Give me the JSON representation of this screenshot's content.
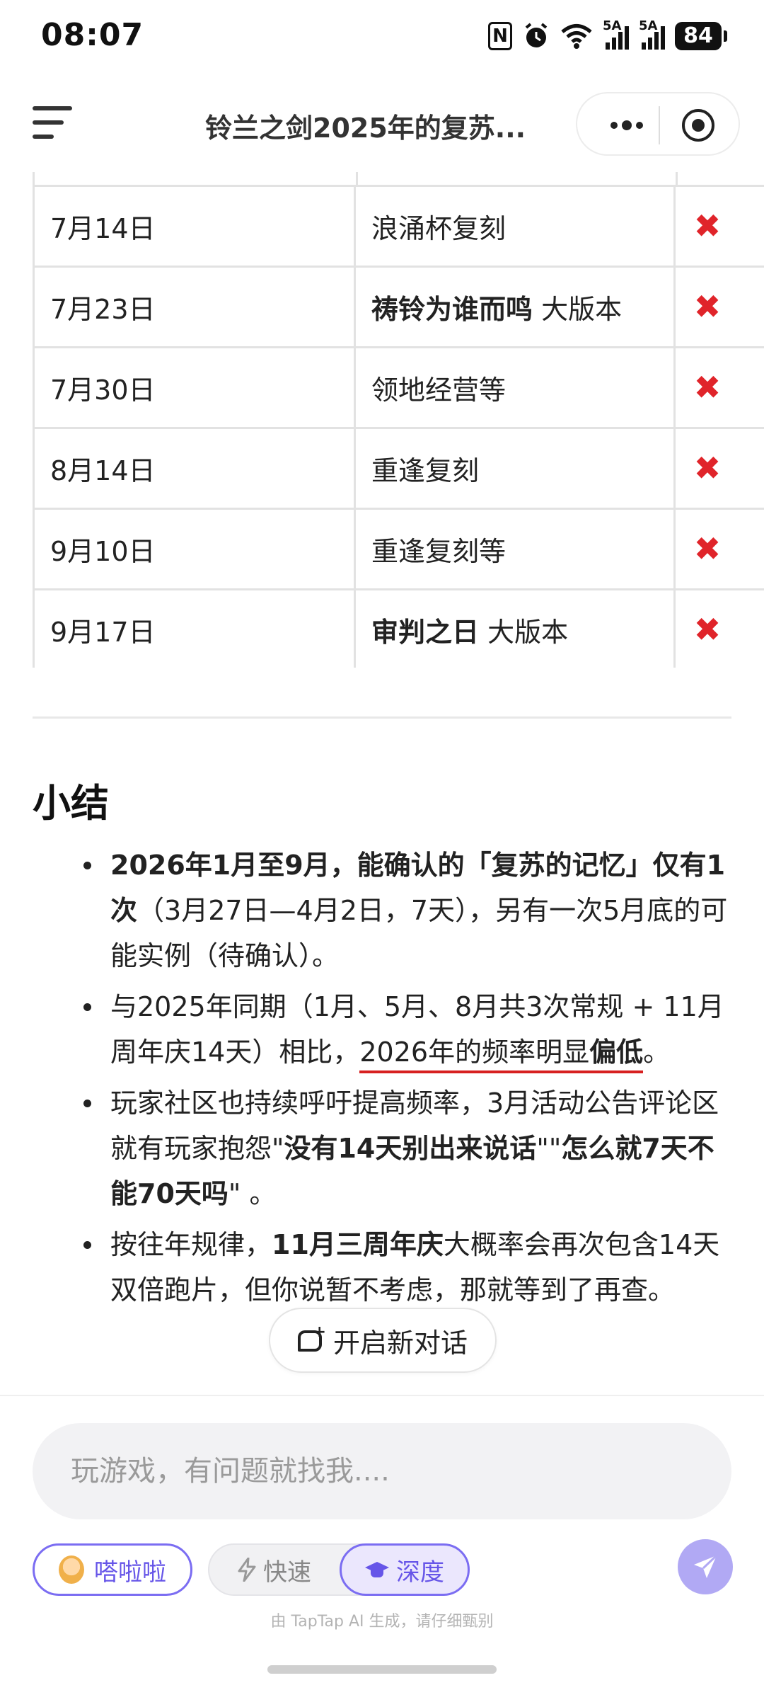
{
  "status_bar": {
    "time": "08:07",
    "signal1_label": "5A",
    "signal2_label": "5A",
    "battery": "84",
    "icons": [
      "nfc-icon",
      "alarm-icon",
      "wifi-icon",
      "signal-icon",
      "signal-icon",
      "battery-icon"
    ]
  },
  "header": {
    "title": "铃兰之剑2025年的复苏..."
  },
  "table": {
    "rows": [
      {
        "date": "7月14日",
        "event_bold": "",
        "event": "浪涌杯复刻",
        "status": "✖"
      },
      {
        "date": "7月23日",
        "event_bold": "祷铃为谁而鸣",
        "event": " 大版本",
        "status": "✖"
      },
      {
        "date": "7月30日",
        "event_bold": "",
        "event": "领地经营等",
        "status": "✖"
      },
      {
        "date": "8月14日",
        "event_bold": "",
        "event": "重逢复刻",
        "status": "✖"
      },
      {
        "date": "9月10日",
        "event_bold": "",
        "event": "重逢复刻等",
        "status": "✖"
      },
      {
        "date": "9月17日",
        "event_bold": "审判之日",
        "event": " 大版本",
        "status": "✖"
      }
    ],
    "status_color": "#e0242a"
  },
  "summary": {
    "title": "小结",
    "b1_bold": "2026年1月至9月，能确认的「复苏的记忆」仅有1次",
    "b1_rest": "（3月27日—4月2日，7天），另有一次5月底的可能实例（待确认）。",
    "b2_start": "与2025年同期（1月、5月、8月共3次常规 + 11月周年庆14天）相比，",
    "b2_under": "2026年的频率明显",
    "b2_under_bold": "偏低",
    "b2_end": "。",
    "b3_start": "玩家社区也持续呼吁提高频率，3月活动公告评论区就有玩家抱怨\"",
    "b3_bold1": "没有14天别出来说话",
    "b3_mid": "\"\"",
    "b3_bold2": "怎么就7天不能70天吗",
    "b3_end": "\" 。",
    "b4_start": "按往年规律，",
    "b4_bold": "11月三周年庆",
    "b4_rest": "大概率会再次包含14天双倍跑片，但你说暂不考虑，那就等到了再查。",
    "underline_color": "#d72020"
  },
  "new_chat": {
    "label": "开启新对话"
  },
  "composer": {
    "placeholder": "玩游戏，有问题就找我....",
    "value": "",
    "agent_label": "嗒啦啦",
    "mode_fast": "快速",
    "mode_deep": "深度",
    "selected_mode": "深度",
    "accent": "#7b6df2",
    "disclaimer": "由 TapTap AI 生成，请仔细甄别"
  }
}
